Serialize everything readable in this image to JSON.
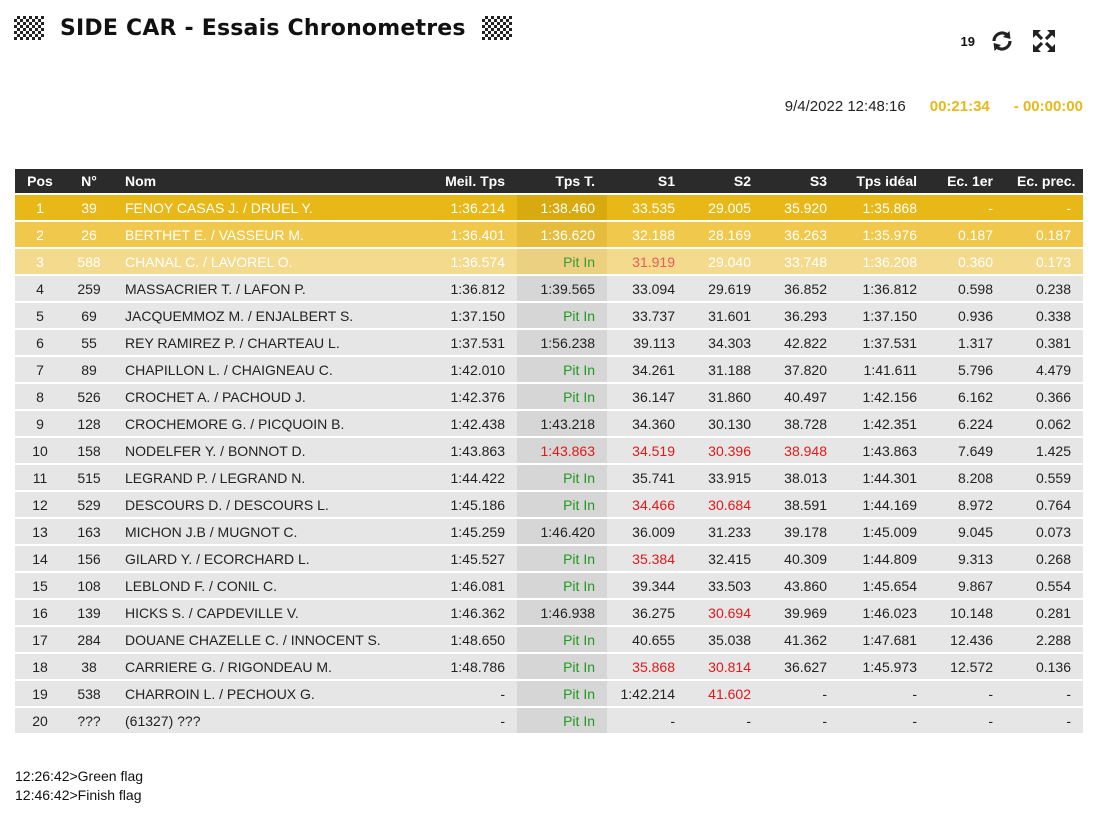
{
  "header": {
    "title": "SIDE CAR - Essais Chronometres",
    "count": "19"
  },
  "info": {
    "datetime": "9/4/2022 12:48:16",
    "elapsed": "00:21:34",
    "remaining": "- 00:00:00"
  },
  "table": {
    "columns": [
      "Pos",
      "N°",
      "Nom",
      "Meil. Tps",
      "Tps T.",
      "S1",
      "S2",
      "S3",
      "Tps idéal",
      "Ec. 1er",
      "Ec. prec."
    ],
    "rows": [
      {
        "pos": "1",
        "num": "39",
        "nom": "FENOY CASAS J. / DRUEL Y.",
        "best": "1:36.214",
        "tps": "1:38.460",
        "s1": "33.535",
        "s2": "29.005",
        "s3": "35.920",
        "ideal": "1:35.868",
        "ec1": "-",
        "ecp": "-"
      },
      {
        "pos": "2",
        "num": "26",
        "nom": "BERTHET E. / VASSEUR M.",
        "best": "1:36.401",
        "tps": "1:36.620",
        "s1": "32.188",
        "s2": "28.169",
        "s3": "36.263",
        "ideal": "1:35.976",
        "ec1": "0.187",
        "ecp": "0.187"
      },
      {
        "pos": "3",
        "num": "588",
        "nom": "CHANAL C. / LAVOREL O.",
        "best": "1:36.574",
        "tps": "Pit In",
        "s1": "31.919",
        "s2": "29.040",
        "s3": "33.748",
        "ideal": "1:36.208",
        "ec1": "0.360",
        "ecp": "0.173"
      },
      {
        "pos": "4",
        "num": "259",
        "nom": "MASSACRIER T. / LAFON P.",
        "best": "1:36.812",
        "tps": "1:39.565",
        "s1": "33.094",
        "s2": "29.619",
        "s3": "36.852",
        "ideal": "1:36.812",
        "ec1": "0.598",
        "ecp": "0.238"
      },
      {
        "pos": "5",
        "num": "69",
        "nom": "JACQUEMMOZ M. / ENJALBERT S.",
        "best": "1:37.150",
        "tps": "Pit In",
        "s1": "33.737",
        "s2": "31.601",
        "s3": "36.293",
        "ideal": "1:37.150",
        "ec1": "0.936",
        "ecp": "0.338"
      },
      {
        "pos": "6",
        "num": "55",
        "nom": "REY RAMIREZ P. / CHARTEAU L.",
        "best": "1:37.531",
        "tps": "1:56.238",
        "s1": "39.113",
        "s2": "34.303",
        "s3": "42.822",
        "ideal": "1:37.531",
        "ec1": "1.317",
        "ecp": "0.381"
      },
      {
        "pos": "7",
        "num": "89",
        "nom": "CHAPILLON L. / CHAIGNEAU C.",
        "best": "1:42.010",
        "tps": "Pit In",
        "s1": "34.261",
        "s2": "31.188",
        "s3": "37.820",
        "ideal": "1:41.611",
        "ec1": "5.796",
        "ecp": "4.479"
      },
      {
        "pos": "8",
        "num": "526",
        "nom": "CROCHET A. / PACHOUD J.",
        "best": "1:42.376",
        "tps": "Pit In",
        "s1": "36.147",
        "s2": "31.860",
        "s3": "40.497",
        "ideal": "1:42.156",
        "ec1": "6.162",
        "ecp": "0.366"
      },
      {
        "pos": "9",
        "num": "128",
        "nom": "CROCHEMORE G. / PICQUOIN B.",
        "best": "1:42.438",
        "tps": "1:43.218",
        "s1": "34.360",
        "s2": "30.130",
        "s3": "38.728",
        "ideal": "1:42.351",
        "ec1": "6.224",
        "ecp": "0.062"
      },
      {
        "pos": "10",
        "num": "158",
        "nom": "NODELFER Y. / BONNOT D.",
        "best": "1:43.863",
        "tps": "1:43.863",
        "s1": "34.519",
        "s2": "30.396",
        "s3": "38.948",
        "ideal": "1:43.863",
        "ec1": "7.649",
        "ecp": "1.425"
      },
      {
        "pos": "11",
        "num": "515",
        "nom": "LEGRAND P. / LEGRAND N.",
        "best": "1:44.422",
        "tps": "Pit In",
        "s1": "35.741",
        "s2": "33.915",
        "s3": "38.013",
        "ideal": "1:44.301",
        "ec1": "8.208",
        "ecp": "0.559"
      },
      {
        "pos": "12",
        "num": "529",
        "nom": "DESCOURS D. / DESCOURS L.",
        "best": "1:45.186",
        "tps": "Pit In",
        "s1": "34.466",
        "s2": "30.684",
        "s3": "38.591",
        "ideal": "1:44.169",
        "ec1": "8.972",
        "ecp": "0.764"
      },
      {
        "pos": "13",
        "num": "163",
        "nom": "MICHON J.B / MUGNOT C.",
        "best": "1:45.259",
        "tps": "1:46.420",
        "s1": "36.009",
        "s2": "31.233",
        "s3": "39.178",
        "ideal": "1:45.009",
        "ec1": "9.045",
        "ecp": "0.073"
      },
      {
        "pos": "14",
        "num": "156",
        "nom": "GILARD Y. / ECORCHARD L.",
        "best": "1:45.527",
        "tps": "Pit In",
        "s1": "35.384",
        "s2": "32.415",
        "s3": "40.309",
        "ideal": "1:44.809",
        "ec1": "9.313",
        "ecp": "0.268"
      },
      {
        "pos": "15",
        "num": "108",
        "nom": "LEBLOND F. / CONIL C.",
        "best": "1:46.081",
        "tps": "Pit In",
        "s1": "39.344",
        "s2": "33.503",
        "s3": "43.860",
        "ideal": "1:45.654",
        "ec1": "9.867",
        "ecp": "0.554"
      },
      {
        "pos": "16",
        "num": "139",
        "nom": "HICKS S. / CAPDEVILLE V.",
        "best": "1:46.362",
        "tps": "1:46.938",
        "s1": "36.275",
        "s2": "30.694",
        "s3": "39.969",
        "ideal": "1:46.023",
        "ec1": "10.148",
        "ecp": "0.281"
      },
      {
        "pos": "17",
        "num": "284",
        "nom": "DOUANE CHAZELLE C. / INNOCENT S.",
        "best": "1:48.650",
        "tps": "Pit In",
        "s1": "40.655",
        "s2": "35.038",
        "s3": "41.362",
        "ideal": "1:47.681",
        "ec1": "12.436",
        "ecp": "2.288"
      },
      {
        "pos": "18",
        "num": "38",
        "nom": "CARRIERE G. / RIGONDEAU M.",
        "best": "1:48.786",
        "tps": "Pit In",
        "s1": "35.868",
        "s2": "30.814",
        "s3": "36.627",
        "ideal": "1:45.973",
        "ec1": "12.572",
        "ecp": "0.136"
      },
      {
        "pos": "19",
        "num": "538",
        "nom": "CHARROIN L. / PECHOUX G.",
        "best": "-",
        "tps": "Pit In",
        "s1": "1:42.214",
        "s2": "41.602",
        "s3": "-",
        "ideal": "-",
        "ec1": "-",
        "ecp": "-"
      },
      {
        "pos": "20",
        "num": "???",
        "nom": "(61327) ???",
        "best": "-",
        "tps": "Pit In",
        "s1": "-",
        "s2": "-",
        "s3": "-",
        "ideal": "-",
        "ec1": "-",
        "ecp": "-"
      }
    ]
  },
  "log": [
    "12:26:42>Green flag",
    "12:46:42>Finish flag"
  ]
}
